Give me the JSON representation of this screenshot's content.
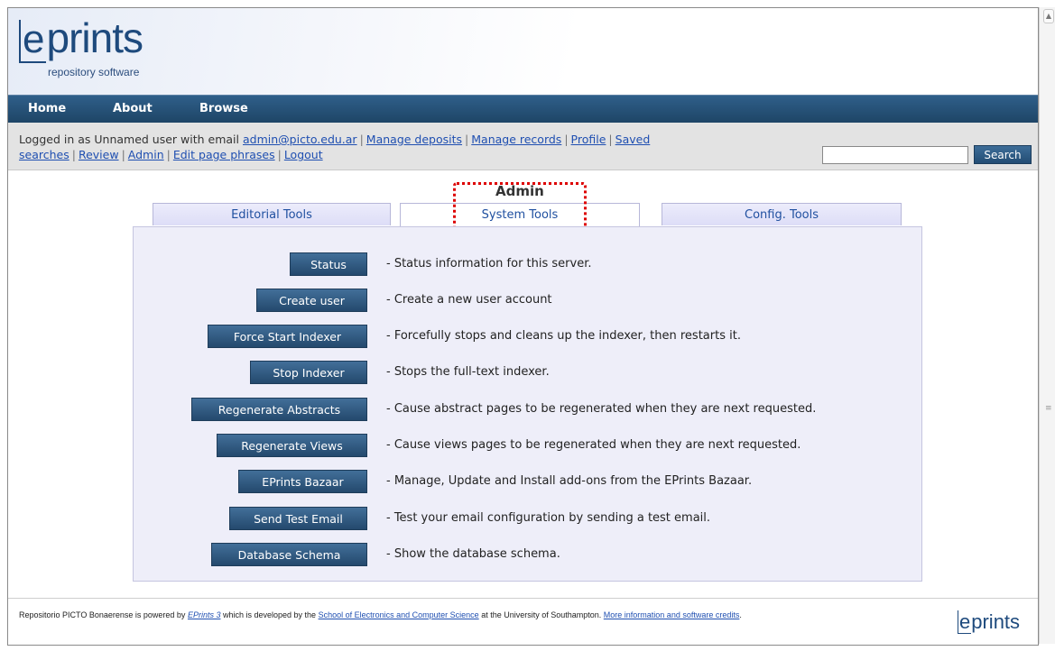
{
  "header": {
    "logo_letter": "e",
    "logo_rest": "prints",
    "logo_subtitle": "repository software"
  },
  "nav": {
    "items": [
      "Home",
      "About",
      "Browse"
    ]
  },
  "userbar": {
    "prefix": "Logged in as Unnamed user with email",
    "email": "admin@picto.edu.ar",
    "links": [
      "Manage deposits",
      "Manage records",
      "Profile",
      "Saved searches",
      "Review",
      "Admin",
      "Edit page phrases",
      "Logout"
    ],
    "search_value": "",
    "search_button": "Search"
  },
  "page": {
    "title": "Admin",
    "tabs": [
      {
        "label": "Editorial Tools",
        "active": false
      },
      {
        "label": "System Tools",
        "active": true
      },
      {
        "label": "Config. Tools",
        "active": false
      }
    ]
  },
  "tools": [
    {
      "button": "Status",
      "desc": "- Status information for this server."
    },
    {
      "button": "Create user",
      "desc": "- Create a new user account"
    },
    {
      "button": "Force Start Indexer",
      "desc": "- Forcefully stops and cleans up the indexer, then restarts it."
    },
    {
      "button": "Stop Indexer",
      "desc": "- Stops the full-text indexer."
    },
    {
      "button": "Regenerate Abstracts",
      "desc": "- Cause abstract pages to be regenerated when they are next requested."
    },
    {
      "button": "Regenerate Views",
      "desc": "- Cause views pages to be regenerated when they are next requested."
    },
    {
      "button": "EPrints Bazaar",
      "desc": "- Manage, Update and Install add-ons from the EPrints Bazaar."
    },
    {
      "button": "Send Test Email",
      "desc": "- Test your email configuration by sending a test email."
    },
    {
      "button": "Database Schema",
      "desc": "- Show the database schema."
    }
  ],
  "footer": {
    "text1": "Repositorio PICTO Bonaerense is powered by",
    "link1": "EPrints 3",
    "text2": "which is developed by the",
    "link2": "School of Electronics and Computer Science",
    "text3": "at the University of Southampton.",
    "link3": "More information and software credits",
    "text4": ".",
    "logo_letter": "e",
    "logo_rest": "prints"
  },
  "colors": {
    "navbar": "#1e4566",
    "accent_link": "#1f4fb1",
    "panel_bg": "#eeeef9",
    "highlight": "#dd0000"
  }
}
